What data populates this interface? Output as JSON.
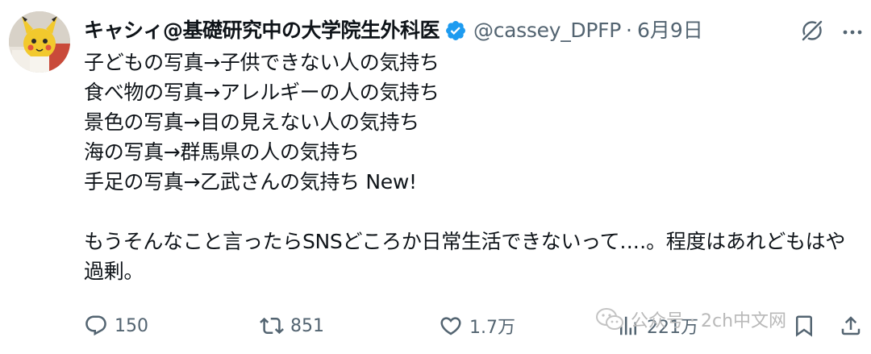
{
  "author": {
    "display_name": "キャシィ@基礎研究中の大学院生外科医",
    "handle": "@cassey_DPFP",
    "separator": "·",
    "date": "6月9日"
  },
  "icons": {
    "avatar": "avatar-image",
    "verified": "verified-badge-icon",
    "grok": "grok-icon",
    "more": "more-icon",
    "reply": "reply-icon",
    "retweet": "retweet-icon",
    "like": "like-icon",
    "views": "views-icon",
    "bookmark": "bookmark-icon",
    "share": "share-icon",
    "watermark": "wechat-icon"
  },
  "tweet": {
    "lines": [
      "子どもの写真→子供できない人の気持ち",
      "食べ物の写真→アレルギーの人の気持ち",
      "景色の写真→目の見えない人の気持ち",
      "海の写真→群馬県の人の気持ち",
      "手足の写真→乙武さんの気持ち New!"
    ],
    "paragraph": "もうそんなこと言ったらSNSどころか日常生活できないって‥‥。程度はあれどもはや過剰。"
  },
  "actions": {
    "reply_count": "150",
    "retweet_count": "851",
    "like_count": "1.7万",
    "views_count": "221万"
  },
  "watermark": {
    "text": "公众号 · 2ch中文网"
  },
  "colors": {
    "verified_blue": "#1d9bf0",
    "muted": "#536471",
    "text": "#0f1419",
    "watermark": "#b9b9b9"
  }
}
